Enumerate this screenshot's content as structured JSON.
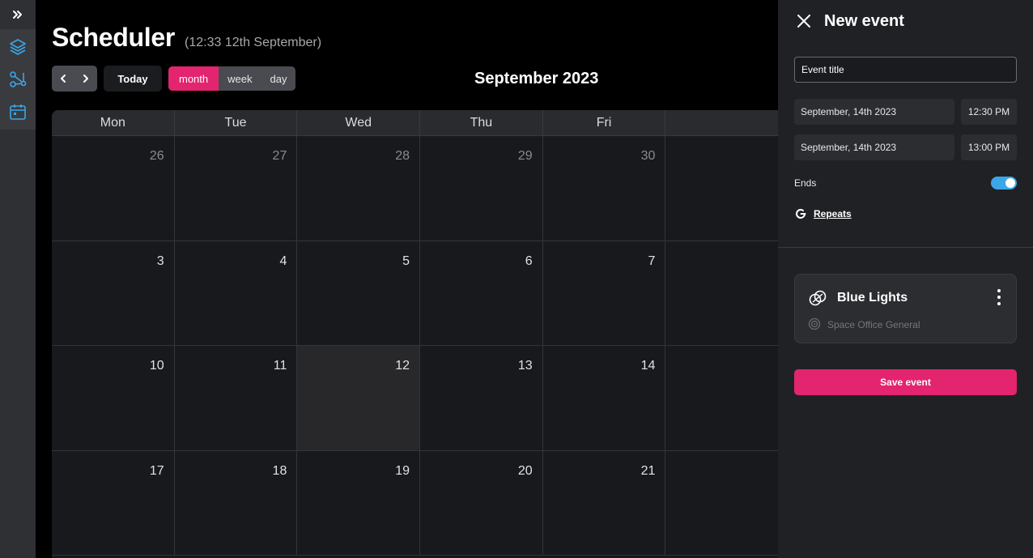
{
  "app": {
    "title": "Scheduler",
    "subtitle": "(12:33 12th September)"
  },
  "sidebar": {
    "items": [
      {
        "icon": "double-chevron-right-icon"
      },
      {
        "icon": "layers-icon",
        "color": "#3ba6e8"
      },
      {
        "icon": "node-graph-icon",
        "color": "#3ba6e8"
      },
      {
        "icon": "calendar-icon",
        "color": "#3ba6e8"
      }
    ]
  },
  "toolbar": {
    "today_label": "Today",
    "views": [
      "month",
      "week",
      "day"
    ],
    "active_view": "month",
    "current_month": "September 2023"
  },
  "calendar": {
    "weekdays": [
      "Mon",
      "Tue",
      "Wed",
      "Thu",
      "Fri"
    ],
    "weeks": [
      [
        "26",
        "27",
        "28",
        "29",
        "30"
      ],
      [
        "3",
        "4",
        "5",
        "6",
        "7"
      ],
      [
        "10",
        "11",
        "12",
        "13",
        "14"
      ],
      [
        "17",
        "18",
        "19",
        "20",
        "21"
      ]
    ],
    "today": "12"
  },
  "panel": {
    "title": "New event",
    "event_title_placeholder": "Event title",
    "start_date": "September, 14th 2023",
    "start_time": "12:30 PM",
    "end_date": "September, 14th 2023",
    "end_time": "13:00 PM",
    "ends_label": "Ends",
    "ends_enabled": true,
    "repeats_label": "Repeats",
    "device": {
      "name": "Blue Lights",
      "space": "Space Office General"
    },
    "save_label": "Save event"
  },
  "colors": {
    "accent": "#e3246e",
    "toggle": "#3ba6e8",
    "panel_bg": "#202125"
  }
}
